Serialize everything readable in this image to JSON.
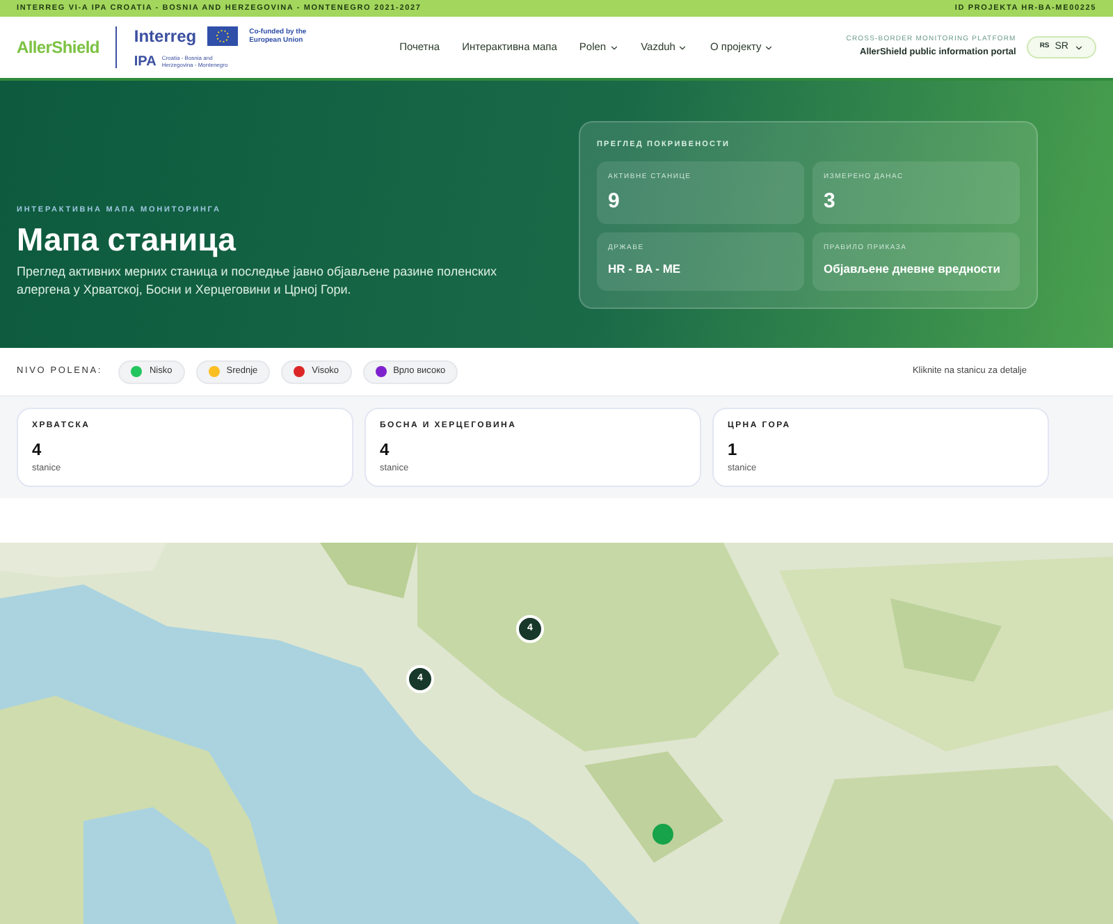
{
  "top_bar": {
    "program": "INTERREG VI-A IPA CROATIA - BOSNIA AND HERZEGOVINA - MONTENEGRO 2021-2027",
    "project_id": "ID PROJEKTA HR-BA-ME00225"
  },
  "header": {
    "brand": "AllerShield",
    "interreg": "Interreg",
    "ipa": "IPA",
    "ipa_sub": "Croatia - Bosnia and Herzegovina - Montenegro",
    "eu": "Co-funded by the European Union",
    "nav": [
      {
        "label": "Почетна",
        "dropdown": false
      },
      {
        "label": "Интерактивна мапа",
        "dropdown": false
      },
      {
        "label": "Polen",
        "dropdown": true
      },
      {
        "label": "Vazduh",
        "dropdown": true
      },
      {
        "label": "О пројекту",
        "dropdown": true
      }
    ],
    "platform_kicker": "CROSS-BORDER MONITORING PLATFORM",
    "platform_title": "AllerShield public information portal",
    "lang_code": "RS",
    "lang": "SR"
  },
  "hero": {
    "kicker": "ИНТЕРАКТИВНА МАПА МОНИТОРИНГА",
    "title": "Мапа станица",
    "description": "Преглед активних мерних станица и последње јавно објављене разине поленских алергена у Хрватској, Босни и Херцеговини и Црној Гори.",
    "overview": {
      "title": "ПРЕГЛЕД ПОКРИВЕНОСТИ",
      "stats": [
        {
          "label": "АКТИВНЕ СТАНИЦЕ",
          "value": "9",
          "kind": "big"
        },
        {
          "label": "ИЗМЕРЕНО ДАНАС",
          "value": "3",
          "kind": "big"
        },
        {
          "label": "ДРЖАВЕ",
          "value": "HR - BA - ME",
          "kind": "small"
        },
        {
          "label": "ПРАВИЛО ПРИКАЗА",
          "value": "Објављене дневне вредности",
          "kind": "small"
        }
      ]
    }
  },
  "legend": {
    "label": "NIVO POLENA:",
    "items": [
      {
        "label": "Nisko",
        "color": "#22c55e"
      },
      {
        "label": "Srednje",
        "color": "#fbbf24"
      },
      {
        "label": "Visoko",
        "color": "#dc2626"
      },
      {
        "label": "Врло високо",
        "color": "#7e22ce"
      }
    ],
    "hint": "Kliknite na stanicu za detalje"
  },
  "countries": [
    {
      "name": "ХРВАТСКА",
      "count": "4",
      "unit": "stanice"
    },
    {
      "name": "БОСНА И ХЕРЦЕГОВИНА",
      "count": "4",
      "unit": "stanice"
    },
    {
      "name": "ЦРНА ГОРА",
      "count": "1",
      "unit": "stanice"
    }
  ],
  "map": {
    "kind": "picture",
    "markers": [
      {
        "kind": "cluster",
        "count": "4"
      },
      {
        "kind": "cluster",
        "count": "4"
      },
      {
        "kind": "station",
        "color": "#16a34a"
      }
    ]
  }
}
